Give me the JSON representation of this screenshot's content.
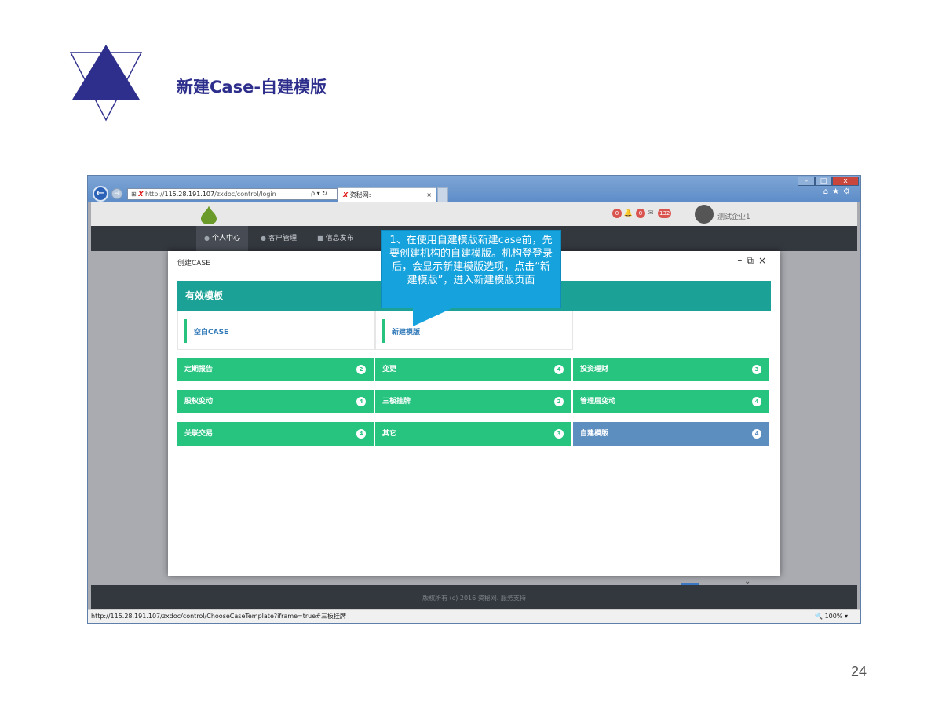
{
  "slide": {
    "title": "新建Case-自建模版",
    "page_number": "24",
    "brand_color": "#2e2f8c"
  },
  "browser": {
    "url": "http://115.28.191.107/zxdoc/control/login",
    "url_host": "115.28.191.107",
    "url_rest": "/zxdoc/control/login",
    "tab_label": "资秘网:",
    "tab_prefix": "X",
    "status_url": "http://115.28.191.107/zxdoc/control/ChooseCaseTemplate?iframe=true#三板挂牌",
    "zoom": "100%"
  },
  "app": {
    "notifications": [
      {
        "count": "0"
      },
      {
        "count": "0"
      },
      {
        "count": "132"
      }
    ],
    "user_name": "测试企业1",
    "nav": [
      {
        "label": "个人中心",
        "icon": "user-icon",
        "active": true
      },
      {
        "label": "客户管理",
        "icon": "chat-icon",
        "active": false
      },
      {
        "label": "信息发布",
        "icon": "document-icon",
        "active": false
      }
    ],
    "footer": "版权所有 (c) 2016 资秘网. 服务支持"
  },
  "modal": {
    "title": "创建CASE",
    "section_header": "有效模板",
    "template_cards": [
      {
        "label": "空白CASE"
      },
      {
        "label": "新建模版"
      }
    ],
    "tiles": [
      {
        "label": "定期报告",
        "count": "2",
        "color": "#27c480"
      },
      {
        "label": "变更",
        "count": "4",
        "color": "#27c480"
      },
      {
        "label": "投资理财",
        "count": "3",
        "color": "#27c480"
      },
      {
        "label": "股权变动",
        "count": "4",
        "color": "#27c480"
      },
      {
        "label": "三板挂牌",
        "count": "2",
        "color": "#27c480"
      },
      {
        "label": "管理层变动",
        "count": "4",
        "color": "#27c480"
      },
      {
        "label": "关联交易",
        "count": "4",
        "color": "#27c480"
      },
      {
        "label": "其它",
        "count": "3",
        "color": "#27c480"
      },
      {
        "label": "自建模版",
        "count": "4",
        "color": "#5d8ec0"
      }
    ]
  },
  "callout": {
    "text": "1、在使用自建模版新建case前，先要创建机构的自建模版。机构登登录后，会显示新建模版选项，点击“新建模版”，进入新建模版页面"
  }
}
